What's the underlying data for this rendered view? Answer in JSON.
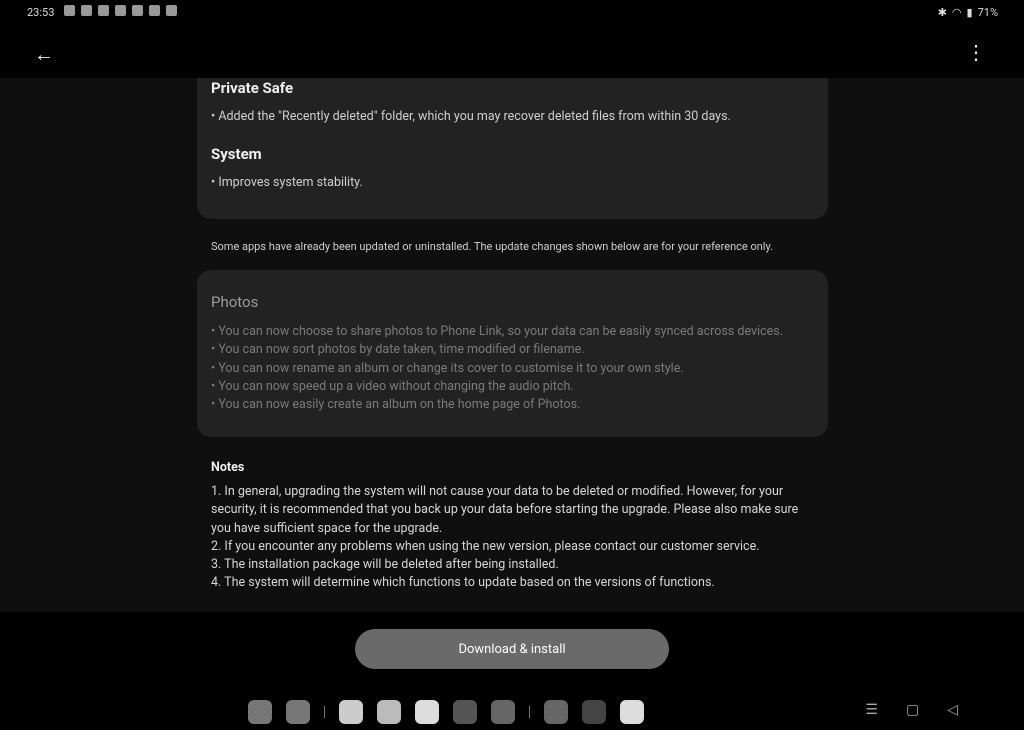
{
  "status": {
    "time": "23:53",
    "battery": "71%"
  },
  "header": {
    "back_icon": "arrow-left-icon",
    "more_icon": "more-vertical-icon"
  },
  "sections": [
    {
      "title": "Private Safe",
      "items": [
        "• Added the \"Recently deleted\" folder, which you may recover deleted files from within 30 days."
      ]
    },
    {
      "title": "System",
      "items": [
        "• Improves system stability."
      ]
    }
  ],
  "reference_note": "Some apps have already been updated or uninstalled. The update changes shown below are for your reference only.",
  "photos": {
    "title": "Photos",
    "items": [
      "• You can now choose to share photos to Phone Link, so your data can be easily synced across devices.",
      "• You can now sort photos by date taken, time modified or filename.",
      "• You can now rename an album or change its cover to customise it to your own style.",
      "• You can now speed up a video without changing the audio pitch.",
      "• You can now easily create an album on the home page of Photos."
    ]
  },
  "notes": {
    "title": "Notes",
    "items": [
      "1. In general, upgrading the system will not cause your data to be deleted or modified. However, for your security, it is recommended that you back up your data before starting the upgrade. Please also make sure you have sufficient space for the upgrade.",
      "2. If you encounter any problems when using the new version, please contact our customer service.",
      "3. The installation package will be deleted after being installed.",
      "4. The system will determine which functions to update based on the versions of functions."
    ]
  },
  "download_label": "Download & install",
  "dock": [
    "app-drawer",
    "file-manager",
    "messages",
    "chrome",
    "camera",
    "gallery",
    "settings",
    "cloud",
    "games",
    "google"
  ]
}
